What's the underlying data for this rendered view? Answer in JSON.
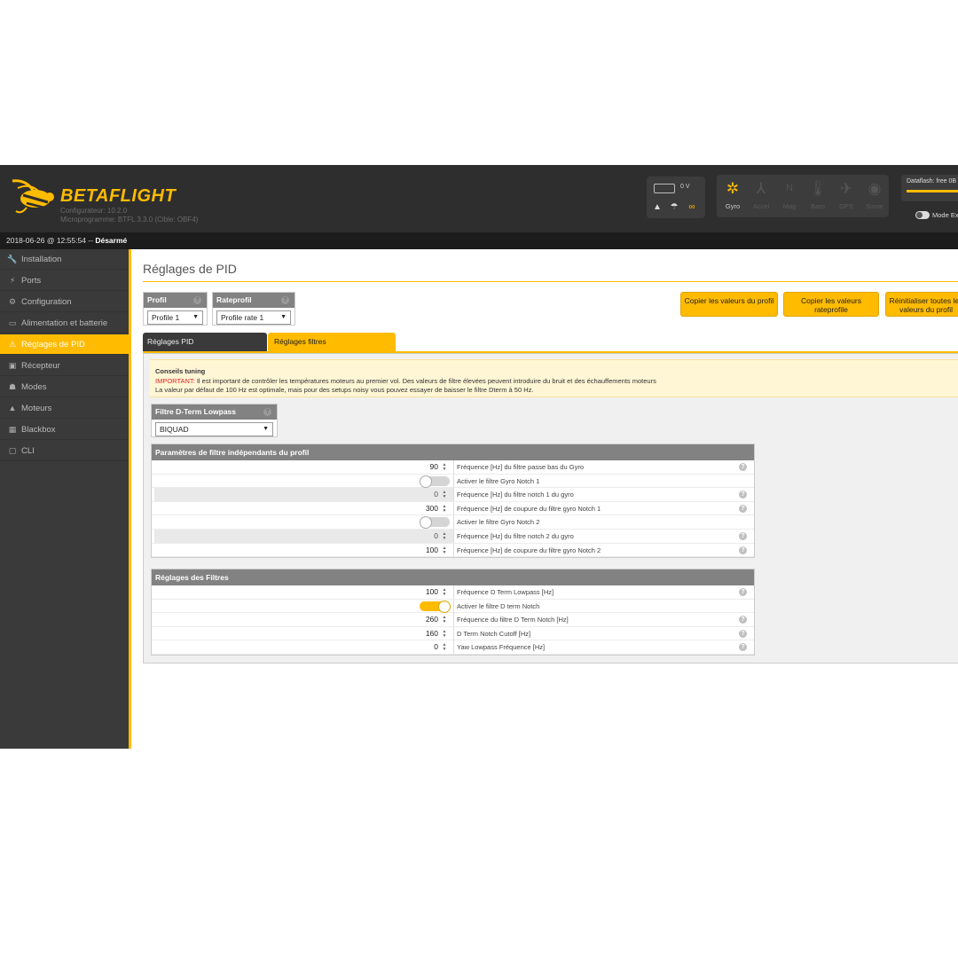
{
  "header": {
    "brand": "BETAFLIGHT",
    "configurator_version": "Configurateur: 10.2.0",
    "firmware_version": "Microprogramme: BTFL 3.3.0 (Cible: OBF4)",
    "battery_voltage": "0 V",
    "sensors": [
      {
        "label": "Gyro",
        "icon": "gyro-icon",
        "active": true
      },
      {
        "label": "Accel",
        "icon": "accel-icon",
        "active": false
      },
      {
        "label": "Mag",
        "icon": "mag-icon",
        "active": false
      },
      {
        "label": "Baro",
        "icon": "baro-icon",
        "active": false
      },
      {
        "label": "GPS",
        "icon": "gps-icon",
        "active": false
      },
      {
        "label": "Sonar",
        "icon": "sonar-icon",
        "active": false
      }
    ],
    "mag_letter": "N",
    "dataflash_label": "Dataflash: free 0B",
    "expert_mode_label": "Mode Ex"
  },
  "status": {
    "datetime": "2018-06-26 @ 12:55:54 --",
    "arm_state": "Désarmé"
  },
  "sidebar": {
    "items": [
      {
        "label": "Installation",
        "icon": "wrench-icon",
        "active": false
      },
      {
        "label": "Ports",
        "icon": "plug-icon",
        "active": false
      },
      {
        "label": "Configuration",
        "icon": "gear-icon",
        "active": false
      },
      {
        "label": "Alimentation et batterie",
        "icon": "battery-icon",
        "active": false
      },
      {
        "label": "Réglages de PID",
        "icon": "pid-icon",
        "active": true
      },
      {
        "label": "Récepteur",
        "icon": "receiver-icon",
        "active": false
      },
      {
        "label": "Modes",
        "icon": "modes-icon",
        "active": false
      },
      {
        "label": "Moteurs",
        "icon": "motor-icon",
        "active": false
      },
      {
        "label": "Blackbox",
        "icon": "blackbox-icon",
        "active": false
      },
      {
        "label": "CLI",
        "icon": "cli-icon",
        "active": false
      }
    ]
  },
  "main": {
    "title": "Réglages de PID",
    "profile": {
      "label": "Profil",
      "value": "Profile 1"
    },
    "rateprofile": {
      "label": "Rateprofil",
      "value": "Profile rate 1"
    },
    "buttons": {
      "copy_profile": "Copier les valeurs du profil",
      "copy_rateprofile": "Copier les valeurs rateprofile",
      "reset_profile": "Réinitialiser toutes les valeurs du profil"
    },
    "tabs": {
      "pid": "Réglages PID",
      "filters": "Réglages filtres"
    },
    "tips": {
      "title": "Conseils tuning",
      "important_prefix": "IMPORTANT:",
      "important_text": " Il est important de contrôler les températures moteurs au premier vol. Des valeurs de filtre élevées peuvent introduire du bruit et des échauffements moteurs",
      "default_text": "La valeur par défaut de 100 Hz est optimale, mais pour des setups noisy vous pouvez essayer de baisser le filtre Dterm à 50 Hz."
    },
    "dterm_lowpass": {
      "label": "Filtre D-Term Lowpass",
      "value": "BIQUAD"
    },
    "profile_independent": {
      "title": "Paramètres de filtre indépendants du profil",
      "rows": [
        {
          "type": "number",
          "value": "90",
          "label": "Fréquence [Hz] du filtre passe bas du Gyro",
          "help": true,
          "shaded": false
        },
        {
          "type": "toggle",
          "on": false,
          "label": "Activer le filtre Gyro Notch 1",
          "help": false,
          "shaded": false
        },
        {
          "type": "number",
          "value": "0",
          "label": "Fréquence [Hz] du filtre notch 1 du gyro",
          "help": true,
          "shaded": true
        },
        {
          "type": "number",
          "value": "300",
          "label": "Fréquence [Hz] de coupure du filtre gyro Notch 1",
          "help": true,
          "shaded": false
        },
        {
          "type": "toggle",
          "on": false,
          "label": "Activer le filtre Gyro Notch 2",
          "help": false,
          "shaded": false
        },
        {
          "type": "number",
          "value": "0",
          "label": "Fréquence [Hz] du filtre notch 2 du gyro",
          "help": true,
          "shaded": true
        },
        {
          "type": "number",
          "value": "100",
          "label": "Fréquence [Hz] de coupure du filtre gyro Notch 2",
          "help": true,
          "shaded": false
        }
      ]
    },
    "filter_settings": {
      "title": "Réglages des Filtres",
      "rows": [
        {
          "type": "number",
          "value": "100",
          "label": "Fréquence D Term Lowpass [Hz]",
          "help": true,
          "shaded": false
        },
        {
          "type": "toggle",
          "on": true,
          "label": "Activer le filtre D term Notch",
          "help": false,
          "shaded": false
        },
        {
          "type": "number",
          "value": "260",
          "label": "Fréquence du filtre D Term Notch [Hz]",
          "help": true,
          "shaded": false
        },
        {
          "type": "number",
          "value": "160",
          "label": "D Term Notch Cutoff [Hz]",
          "help": true,
          "shaded": false
        },
        {
          "type": "number",
          "value": "0",
          "label": "Yaw Lowpass Fréquence [Hz]",
          "help": true,
          "shaded": false
        }
      ]
    }
  },
  "colors": {
    "accent": "#ffbb00",
    "header_bg": "#2e2e2e",
    "sidebar_bg": "#3a3a3a",
    "important_red": "#e02020"
  }
}
